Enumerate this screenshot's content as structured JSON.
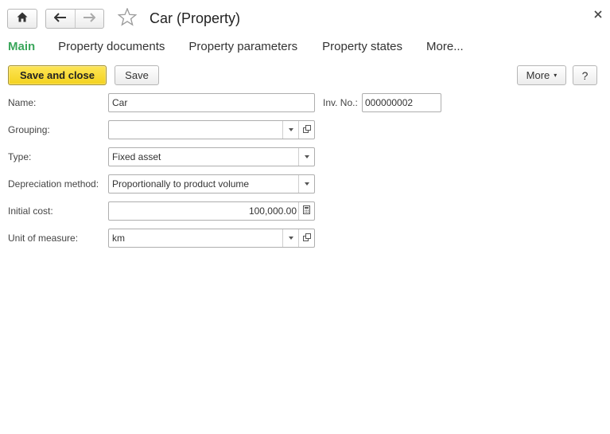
{
  "window": {
    "title": "Car (Property)"
  },
  "tabs": [
    {
      "label": "Main",
      "active": true
    },
    {
      "label": "Property documents"
    },
    {
      "label": "Property parameters"
    },
    {
      "label": "Property states"
    },
    {
      "label": "More..."
    }
  ],
  "toolbar": {
    "save_and_close_label": "Save and close",
    "save_label": "Save",
    "more_label": "More",
    "help_label": "?"
  },
  "form": {
    "name": {
      "label": "Name:",
      "value": "Car"
    },
    "inv_no": {
      "label": "Inv. No.:",
      "value": "000000002"
    },
    "grouping": {
      "label": "Grouping:",
      "value": ""
    },
    "type": {
      "label": "Type:",
      "value": "Fixed asset"
    },
    "depreciation_method": {
      "label": "Depreciation method:",
      "value": "Proportionally to product volume"
    },
    "initial_cost": {
      "label": "Initial cost:",
      "value": "100,000.00"
    },
    "unit_of_measure": {
      "label": "Unit of measure:",
      "value": "km"
    }
  },
  "icons": {
    "home": "home-icon",
    "back": "arrow-left-icon",
    "forward": "arrow-right-icon",
    "favorite": "star-icon",
    "close": "close-icon",
    "dropdown": "chevron-down-icon",
    "open": "open-form-icon",
    "calculator": "calculator-icon"
  },
  "colors": {
    "active_tab": "#3aa65b",
    "primary_button": "#f4d21e"
  }
}
